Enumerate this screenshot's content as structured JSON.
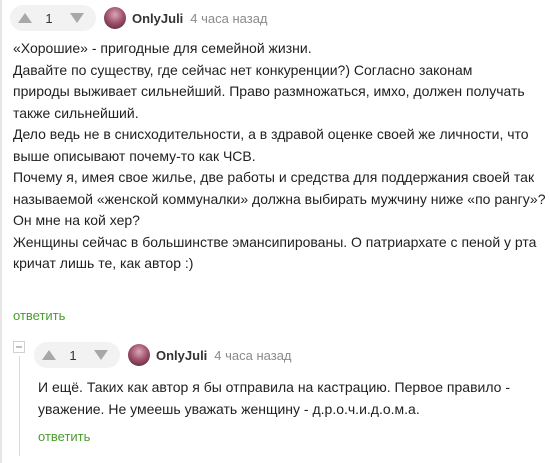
{
  "comment": {
    "votes": "1",
    "author": "OnlyJuli",
    "time": "4 часа назад",
    "lines": [
      "«Хорошие» - пригодные для семейной жизни.",
      "Давайте по существу, где сейчас нет конкуренции?) Согласно законам",
      "природы выживает сильнейший. Право размножаться, имхо, должен получать",
      "также сильнейший.",
      "Дело ведь не в снисходительности, а в здравой оценке своей же личности, что",
      "выше описывают почему-то как ЧСВ.",
      "Почему я, имея свое жилье, две работы и средства для поддержания своей так",
      "называемой «женской коммуналки» должна выбирать мужчину ниже «по рангу»?",
      "Он мне на кой хер?",
      "Женщины сейчас в большинстве эмансипированы. О патриархате с пеной у рта",
      "кричат лишь те, как автор :)"
    ],
    "reply_label": "ответить"
  },
  "reply": {
    "votes": "1",
    "author": "OnlyJuli",
    "time": "4 часа назад",
    "lines": [
      "И ещё. Таких как автор я бы отправила на кастрацию. Первое правило -",
      "уважение. Не умеешь уважать женщину - д.р.о.ч.и.д.о.м.а."
    ],
    "reply_label": "ответить"
  },
  "icons": {
    "upvote": "triangle-up-icon",
    "downvote": "triangle-down-icon",
    "collapse": "minus-icon"
  },
  "colors": {
    "reply_link": "#4a9b2e",
    "vote_bg": "#f2f2f2",
    "arrow": "#a8a8a8"
  }
}
